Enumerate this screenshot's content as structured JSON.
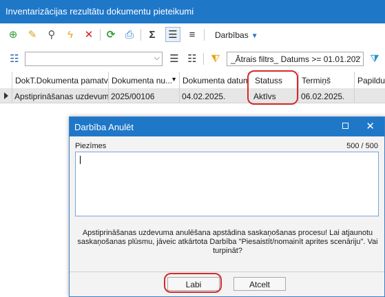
{
  "window": {
    "title": "Inventarizācijas rezultātu dokumentu pieteikumi"
  },
  "toolbar": {
    "icons": [
      "add-green-icon",
      "edit-icon",
      "view-icon",
      "lightning-icon",
      "delete-red-icon",
      "refresh-icon",
      "print-icon",
      "sigma-icon",
      "grid-columns-icon",
      "tree-list-icon"
    ],
    "actions_label": "Darbības"
  },
  "filterbar": {
    "filter_value": "",
    "quick_filter": "_Ātrais filtrs_ Datums >= 01.01.202"
  },
  "grid": {
    "columns": [
      "DokT.Dokumenta pamatv...",
      "Dokumenta nu...",
      "Dokumenta datums",
      "Statuss",
      "Termiņš",
      "Papildu"
    ],
    "rows": [
      [
        "Apstiprināšanas uzdevums",
        "2025/00106",
        "04.02.2025.",
        "Aktīvs",
        "06.02.2025.",
        ""
      ]
    ]
  },
  "dialog": {
    "title": "Darbība Anulēt",
    "notes_label": "Piezīmes",
    "char_count": "500 / 500",
    "notes_value": "",
    "message": "Apstiprināšanas uzdevuma anulēšana apstādina saskaņošanas procesu! Lai atjaunotu saskaņošanas plūsmu, jāveic atkārtota Darbība \"Piesaistīt/nomainīt aprites scenāriju\". Vai turpināt?",
    "ok_label": "Labi",
    "cancel_label": "Atcelt"
  },
  "colors": {
    "accent": "#1f77c8",
    "highlight": "#d42a2a"
  }
}
